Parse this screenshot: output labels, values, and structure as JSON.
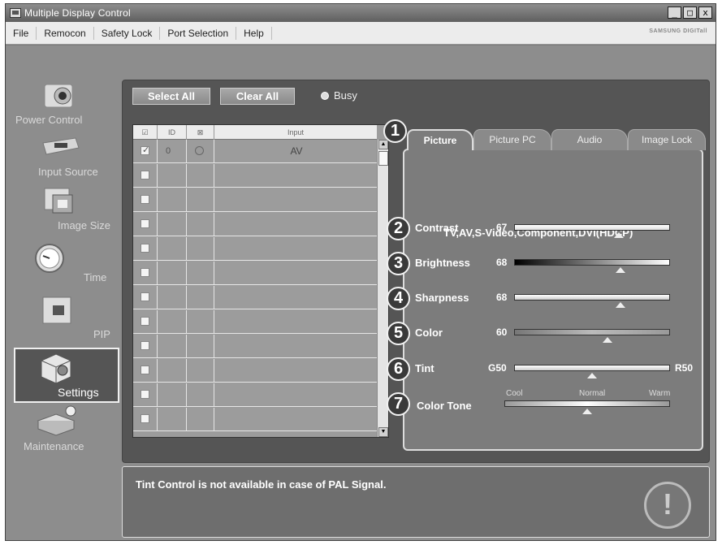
{
  "window": {
    "title": "Multiple Display Control",
    "controls": [
      "_",
      "□",
      "x"
    ]
  },
  "menu": {
    "items": [
      "File",
      "Remocon",
      "Safety Lock",
      "Port Selection",
      "Help"
    ],
    "brand": "SAMSUNG DIGITall"
  },
  "nav": {
    "items": [
      {
        "label": "Power Control",
        "icon": "power-camera-icon"
      },
      {
        "label": "Input Source",
        "icon": "input-source-icon"
      },
      {
        "label": "Image Size",
        "icon": "image-size-icon"
      },
      {
        "label": "Time",
        "icon": "clock-icon"
      },
      {
        "label": "PIP",
        "icon": "pip-icon"
      },
      {
        "label": "Settings",
        "icon": "settings-cube-icon"
      },
      {
        "label": "Maintenance",
        "icon": "maintenance-icon"
      }
    ],
    "active": "Settings"
  },
  "toolbar": {
    "select_all": "Select All",
    "clear_all": "Clear All",
    "busy": "Busy"
  },
  "grid": {
    "columns": {
      "check": "☑",
      "id": "ID",
      "status": "⊠",
      "input": "Input"
    },
    "rows": [
      {
        "checked": true,
        "id": "0",
        "input": "AV"
      },
      {
        "checked": false,
        "id": "",
        "input": ""
      },
      {
        "checked": false,
        "id": "",
        "input": ""
      },
      {
        "checked": false,
        "id": "",
        "input": ""
      },
      {
        "checked": false,
        "id": "",
        "input": ""
      },
      {
        "checked": false,
        "id": "",
        "input": ""
      },
      {
        "checked": false,
        "id": "",
        "input": ""
      },
      {
        "checked": false,
        "id": "",
        "input": ""
      },
      {
        "checked": false,
        "id": "",
        "input": ""
      },
      {
        "checked": false,
        "id": "",
        "input": ""
      },
      {
        "checked": false,
        "id": "",
        "input": ""
      },
      {
        "checked": false,
        "id": "",
        "input": ""
      }
    ]
  },
  "tabs": [
    "Picture",
    "Picture PC",
    "Audio",
    "Image Lock"
  ],
  "active_tab": "Picture",
  "mode_text": "TV,AV,S-Video,Component,DVI(HDCP)",
  "badges": [
    "1",
    "2",
    "3",
    "4",
    "5",
    "6",
    "7"
  ],
  "settings": {
    "contrast": {
      "label": "Contrast",
      "value": "67",
      "level": 0.67
    },
    "brightness": {
      "label": "Brightness",
      "value": "68",
      "level": 0.68
    },
    "sharpness": {
      "label": "Sharpness",
      "value": "68",
      "level": 0.68
    },
    "color": {
      "label": "Color",
      "value": "60",
      "level": 0.6
    },
    "tint": {
      "label": "Tint",
      "left": "G50",
      "right": "R50",
      "level": 0.5
    },
    "color_tone": {
      "label": "Color Tone",
      "options": [
        "Cool",
        "Normal",
        "Warm"
      ],
      "selected": "Normal"
    }
  },
  "message": "Tint Control is not available in case of PAL Signal.",
  "warning_icon": "!"
}
